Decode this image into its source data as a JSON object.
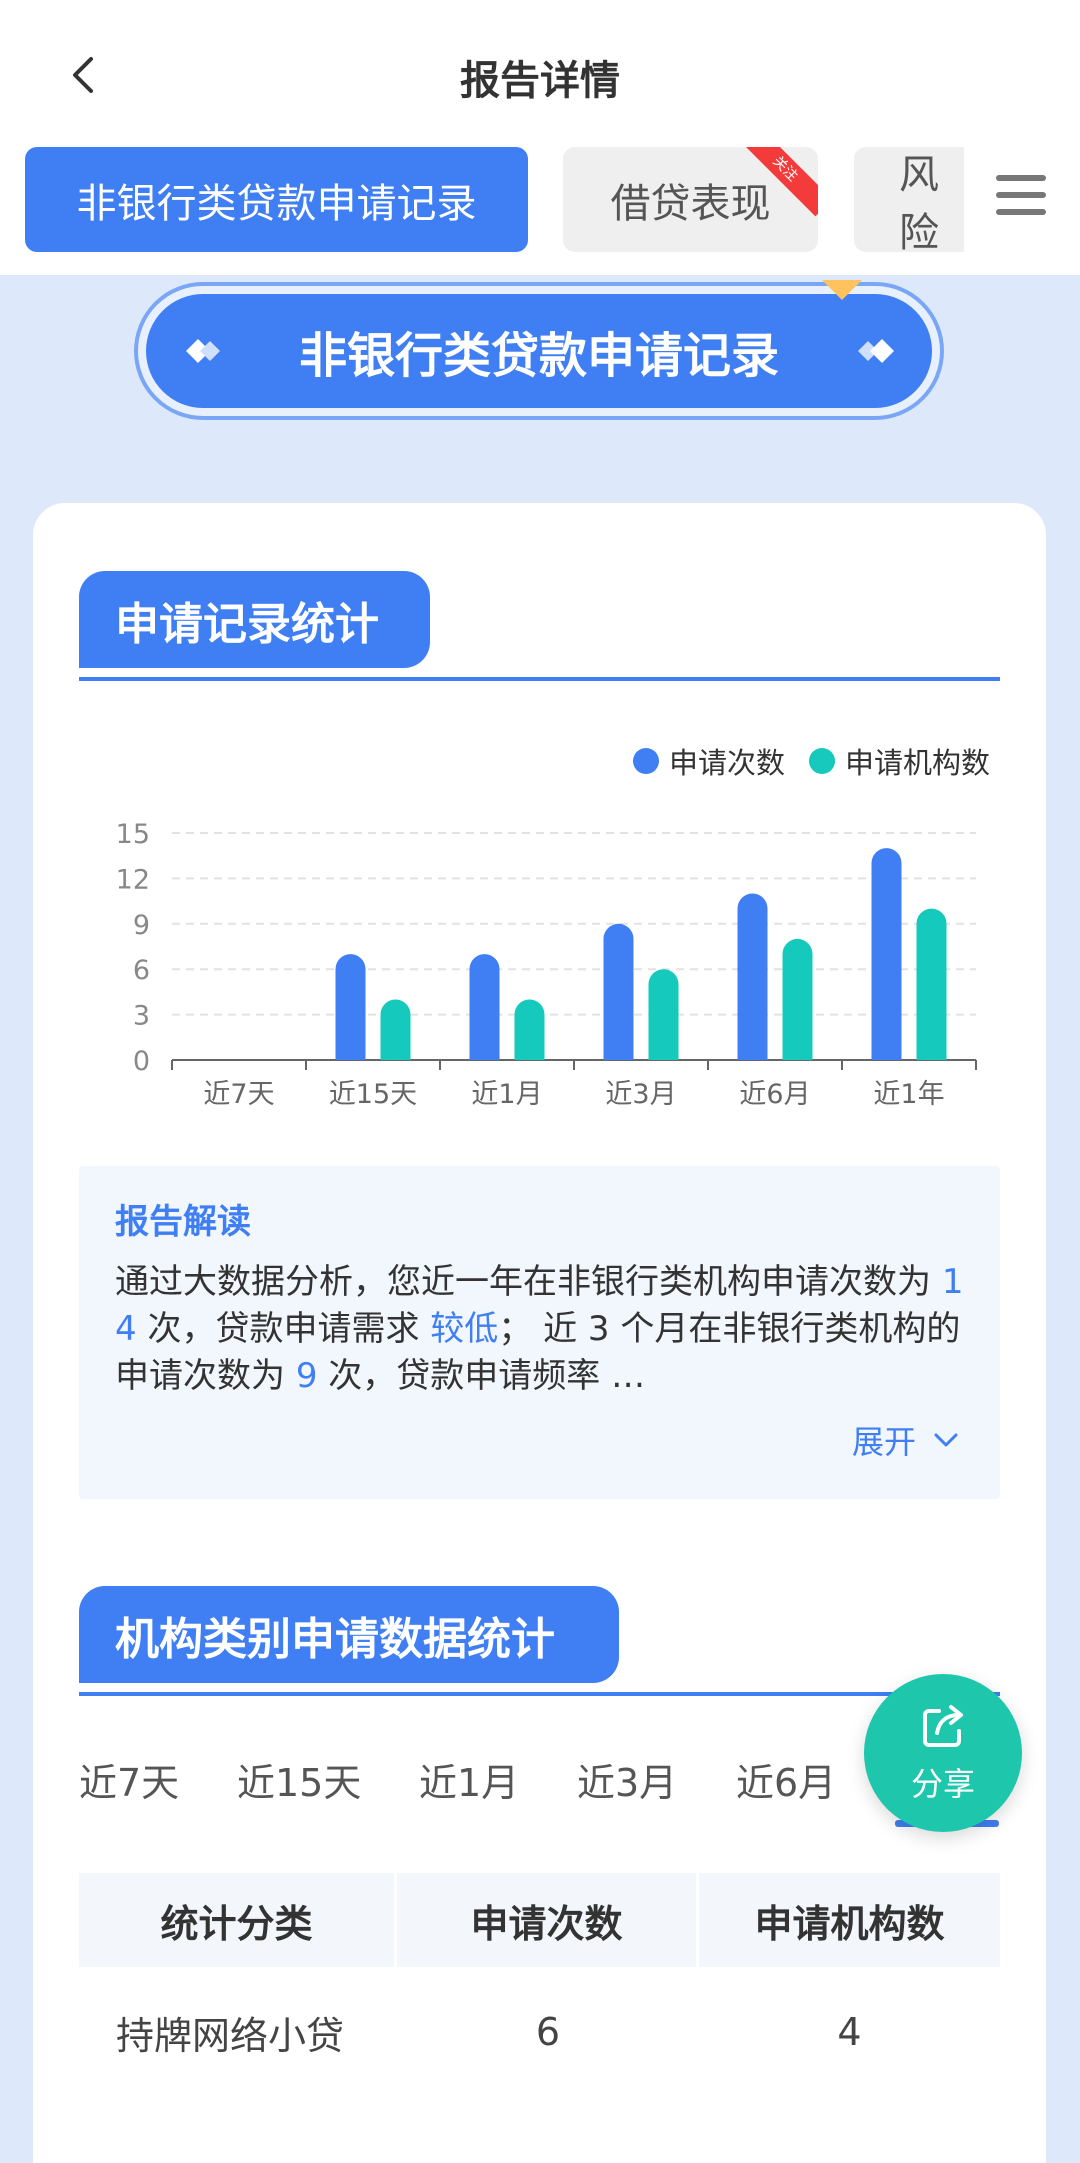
{
  "header": {
    "title": "报告详情"
  },
  "tabs": [
    {
      "label": "非银行类贷款申请记录",
      "active": true
    },
    {
      "label": "借贷表现",
      "badge": "关注"
    },
    {
      "label": "风险"
    }
  ],
  "section_banner": {
    "title": "非银行类贷款申请记录"
  },
  "stats_section": {
    "title": "申请记录统计"
  },
  "colors": {
    "primary": "#3f7ff3",
    "teal": "#16c9bd",
    "share": "#1ec6ac"
  },
  "chart_data": {
    "type": "bar",
    "categories": [
      "近7天",
      "近15天",
      "近1月",
      "近3月",
      "近6月",
      "近1年"
    ],
    "series": [
      {
        "name": "申请次数",
        "color": "#3f7ff3",
        "values": [
          0,
          7,
          7,
          9,
          11,
          14
        ]
      },
      {
        "name": "申请机构数",
        "color": "#16c9bd",
        "values": [
          0,
          4,
          4,
          6,
          8,
          10
        ]
      }
    ],
    "yticks": [
      0,
      3,
      6,
      9,
      12,
      15
    ],
    "ylim": [
      0,
      15
    ],
    "grid": true,
    "legend": "top-right"
  },
  "interpretation": {
    "title": "报告解读",
    "text_1": "通过大数据分析，您近一年在非银行类机构申请次数为 ",
    "count_year": "14",
    "text_2": " 次，贷款申请需求 ",
    "demand_level": "较低",
    "text_3": "； 近 3 个月在非银行类机构的申请次数为 ",
    "count_3m": "9",
    "text_4": " 次，贷款申请频率 …",
    "expand_label": "展开"
  },
  "institution_section": {
    "title": "机构类别申请数据统计",
    "periods": [
      "近7天",
      "近15天",
      "近1月",
      "近3月",
      "近6月"
    ],
    "table": {
      "headers": [
        "统计分类",
        "申请次数",
        "申请机构数"
      ],
      "rows": [
        {
          "category": "持牌网络小贷",
          "applications": "6",
          "institutions": "4"
        }
      ]
    }
  },
  "share_button": {
    "label": "分享"
  }
}
